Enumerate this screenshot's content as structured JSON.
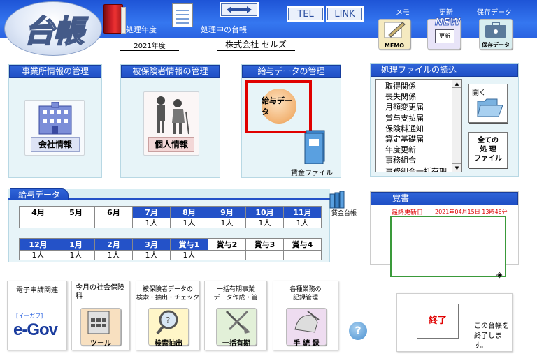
{
  "app": {
    "title": "台帳"
  },
  "header": {
    "year_label": "処理年度",
    "year_value": "2021年度",
    "ledger_label": "処理中の台帳",
    "ledger_value": "株式会社 セルズ",
    "tel_label": "TEL",
    "link_label": "LINK"
  },
  "top_right": {
    "memo_caption": "メモ",
    "memo_tile": "MEMO",
    "update_caption": "更新",
    "update_tile": "更新",
    "update_badge": "NEW",
    "save_caption": "保存データ",
    "save_tile": "保存データ"
  },
  "sections": {
    "office": {
      "title": "事業所情報の管理",
      "button": "会社情報"
    },
    "insured": {
      "title": "被保険者情報の管理",
      "button": "個人情報"
    },
    "salary": {
      "title": "給与データの管理",
      "button": "給与データ",
      "file": "賃金ファイル"
    }
  },
  "file_reader": {
    "title": "処理ファイルの読込",
    "items": [
      "取得関係",
      "喪失関係",
      "月額変更届",
      "賞与支払届",
      "保険料通知",
      "算定基礎届",
      "年度更新",
      "事務組合",
      "事務組合一括有期"
    ],
    "open_button": "開く",
    "all_files_button_l1": "全ての",
    "all_files_button_l2": "処 理",
    "all_files_button_l3": "ファイル"
  },
  "salary_data": {
    "title": "給与データ",
    "ledger_book": "賃金台帳",
    "row1": [
      {
        "m": "4月",
        "v": ""
      },
      {
        "m": "5月",
        "v": ""
      },
      {
        "m": "6月",
        "v": ""
      },
      {
        "m": "7月",
        "v": "1人"
      },
      {
        "m": "8月",
        "v": "1人"
      },
      {
        "m": "9月",
        "v": "1人"
      },
      {
        "m": "10月",
        "v": "1人"
      },
      {
        "m": "11月",
        "v": "1人"
      }
    ],
    "row2": [
      {
        "m": "12月",
        "v": "1人"
      },
      {
        "m": "1月",
        "v": "1人"
      },
      {
        "m": "2月",
        "v": "1人"
      },
      {
        "m": "3月",
        "v": "1人"
      },
      {
        "m": "賞与1",
        "v": "1人"
      },
      {
        "m": "賞与2",
        "v": ""
      },
      {
        "m": "賞与3",
        "v": ""
      },
      {
        "m": "賞与4",
        "v": ""
      }
    ]
  },
  "notes": {
    "title": "覚書",
    "last_updated_label": "最終更新日",
    "last_updated_value": "2021年04月15日 13時46分"
  },
  "tools": {
    "egov_label": "電子申請関連",
    "egov_logo": "e-Gov",
    "egov_ruby": "[イーガブ]",
    "social_label": "今月の社会保険料",
    "social_tile": "ツール",
    "search_label_l1": "被保険者データの",
    "search_label_l2": "検索・抽出・チェック",
    "search_tile": "検索抽出",
    "lump_label_l1": "一括有期事業",
    "lump_label_l2": "データ作成・管",
    "lump_tile": "一括有期",
    "records_label_l1": "各種業務の",
    "records_label_l2": "記録管理",
    "records_tile": "手 続 録",
    "help": "?"
  },
  "exit": {
    "button": "終了",
    "desc_l1": "この台帳を",
    "desc_l2": "終了します。"
  },
  "colors": {
    "header_blue": "#2a62e0",
    "panel_bg": "#e7f4f8",
    "highlight_red": "#e00000"
  }
}
